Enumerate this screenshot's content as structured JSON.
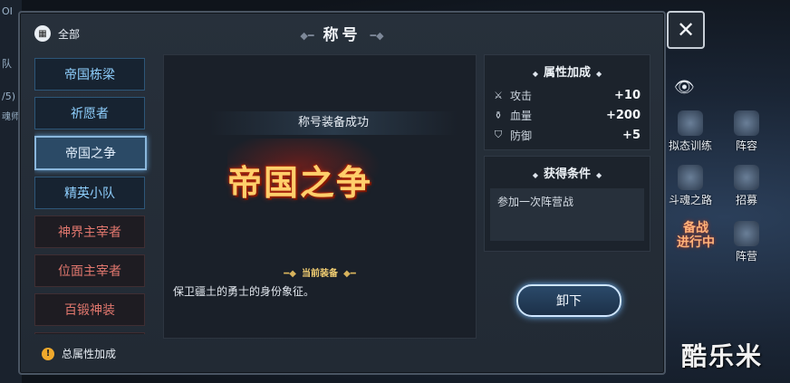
{
  "window": {
    "title": "称号",
    "all_tab": "全部",
    "close": "✕"
  },
  "titles": [
    {
      "label": "帝国栋梁",
      "style": "gold"
    },
    {
      "label": "祈愿者",
      "style": "gold"
    },
    {
      "label": "帝国之争",
      "style": "selected"
    },
    {
      "label": "精英小队",
      "style": "gold"
    },
    {
      "label": "神界主宰者",
      "style": "red"
    },
    {
      "label": "位面主宰者",
      "style": "red"
    },
    {
      "label": "百锻神装",
      "style": "red"
    }
  ],
  "center": {
    "equip_message": "称号装备成功",
    "big_title": "帝国之争",
    "current_equipped": "当前装备",
    "description": "保卫疆土的勇士的身份象征。"
  },
  "attributes": {
    "title": "属性加成",
    "stats": [
      {
        "icon": "sword-icon",
        "name": "攻击",
        "value": "+10"
      },
      {
        "icon": "potion-icon",
        "name": "血量",
        "value": "+200"
      },
      {
        "icon": "shield-icon",
        "name": "防御",
        "value": "+5"
      }
    ]
  },
  "conditions": {
    "title": "获得条件",
    "text": "参加一次阵营战"
  },
  "unequip_button": "卸下",
  "total_attr": "总属性加成",
  "side_menu": {
    "items": [
      "拟态训练",
      "阵容",
      "斗魂之路",
      "招募",
      "阵营"
    ],
    "fight_line1": "备战",
    "fight_line2": "进行中"
  },
  "background_left": {
    "line1": "OI",
    "line2": "队",
    "line3": "/5)",
    "line4": "魂师"
  },
  "watermark": "酷乐米"
}
